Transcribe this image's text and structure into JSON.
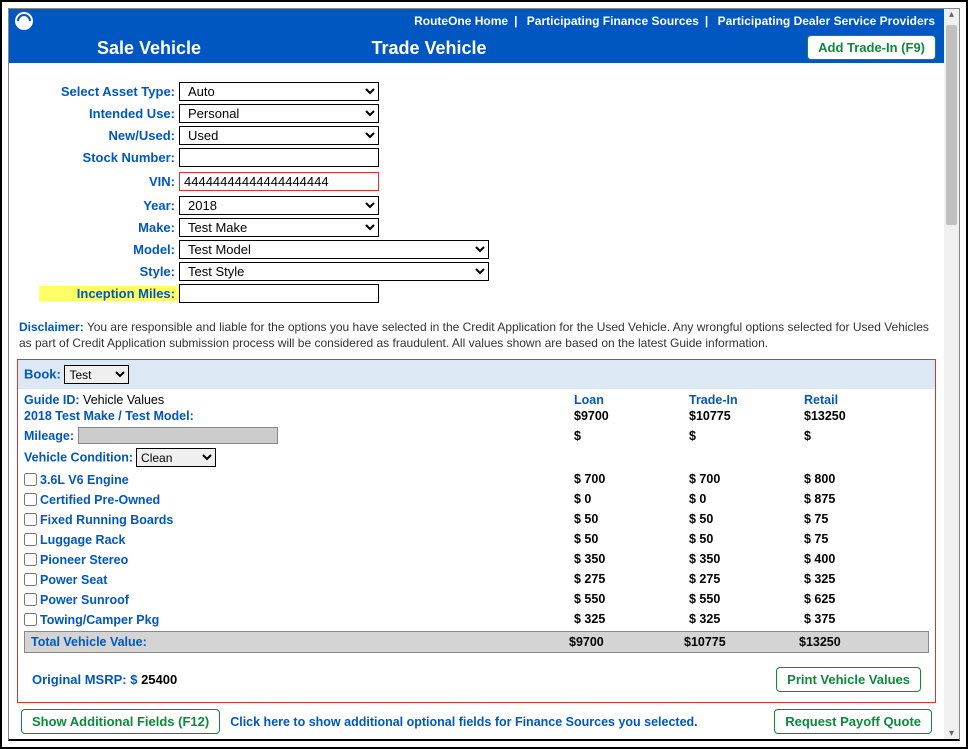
{
  "topnav": {
    "home": "RouteOne Home",
    "pfs": "Participating Finance Sources",
    "pdsp": "Participating Dealer Service Providers"
  },
  "tabs": {
    "sale": "Sale Vehicle",
    "trade": "Trade Vehicle",
    "add_tradein": "Add Trade-In (F9)"
  },
  "form": {
    "labels": {
      "asset_type": "Select Asset Type:",
      "intended_use": "Intended Use:",
      "new_used": "New/Used:",
      "stock_number": "Stock Number:",
      "vin": "VIN:",
      "year": "Year:",
      "make": "Make:",
      "model": "Model:",
      "style": "Style:",
      "inception_miles": "Inception Miles:"
    },
    "values": {
      "asset_type": "Auto",
      "intended_use": "Personal",
      "new_used": "Used",
      "stock_number": "",
      "vin": "44444444444444444444",
      "year": "2018",
      "make": "Test Make",
      "model": "Test Model",
      "style": "Test Style",
      "inception_miles": ""
    }
  },
  "disclaimer_label": "Disclaimer:",
  "disclaimer_text": " You are responsible and liable for the options you have selected in the Credit Application for the Used Vehicle. Any wrongful options selected for Used Vehicles as part of Credit Application submission process will be considered as fraudulent. All values shown are based on the latest Guide information.",
  "book": {
    "label": "Book:",
    "value": "Test",
    "guide_id_label": "Guide ID:",
    "guide_id_value": "Vehicle Values",
    "vehicle_line": "2018 Test Make / Test Model:",
    "mileage_label": "Mileage:",
    "condition_label": "Vehicle Condition:",
    "condition_value": "Clean",
    "cols": {
      "loan": "Loan",
      "tradein": "Trade-In",
      "retail": "Retail"
    },
    "base": {
      "loan": "$9700",
      "tradein": "$10775",
      "retail": "$13250"
    },
    "mileage_row": {
      "loan": "$",
      "tradein": "$",
      "retail": "$"
    },
    "options": [
      {
        "name": "3.6L V6 Engine",
        "loan": "$ 700",
        "tradein": "$ 700",
        "retail": "$ 800"
      },
      {
        "name": "Certified Pre-Owned",
        "loan": "$ 0",
        "tradein": "$ 0",
        "retail": "$ 875"
      },
      {
        "name": "Fixed Running Boards",
        "loan": "$ 50",
        "tradein": "$ 50",
        "retail": "$ 75"
      },
      {
        "name": "Luggage Rack",
        "loan": "$ 50",
        "tradein": "$ 50",
        "retail": "$ 75"
      },
      {
        "name": "Pioneer Stereo",
        "loan": "$ 350",
        "tradein": "$ 350",
        "retail": "$ 400"
      },
      {
        "name": "Power Seat",
        "loan": "$ 275",
        "tradein": "$ 275",
        "retail": "$ 325"
      },
      {
        "name": "Power Sunroof",
        "loan": "$ 550",
        "tradein": "$ 550",
        "retail": "$ 625"
      },
      {
        "name": "Towing/Camper Pkg",
        "loan": "$ 325",
        "tradein": "$ 325",
        "retail": "$ 375"
      }
    ],
    "total_label": "Total  Vehicle  Value:",
    "total": {
      "loan": "$9700",
      "tradein": "$10775",
      "retail": "$13250"
    },
    "msrp_label": "Original MSRP: $",
    "msrp_value": " 25400",
    "print_btn": "Print Vehicle Values"
  },
  "footer": {
    "show_fields": "Show Additional Fields (F12)",
    "hint": "Click here to show additional optional fields for Finance Sources you selected.",
    "payoff": "Request Payoff Quote"
  }
}
